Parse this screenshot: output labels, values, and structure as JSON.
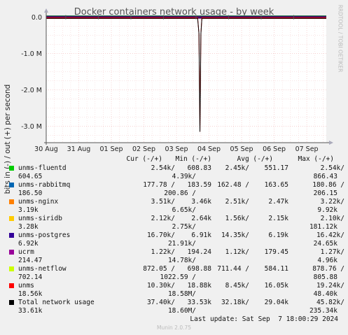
{
  "title": "Docker containers network usage - by week",
  "side_label": "RRDTOOL / TOBI OETIKER",
  "footer": "Last update: Sat Sep  7 18:00:29 2024",
  "munin": "Munin 2.0.75",
  "legend_header": {
    "cur": "Cur (-/+)",
    "min": "Min (-/+)",
    "avg": "Avg (-/+)",
    "max": "Max (-/+)"
  },
  "legend": [
    {
      "name": "unms-fluentd",
      "color": "#00cc00",
      "cur": "2.54k/",
      "min": "608.83",
      "min_wrap": "4.39k/",
      "avg": "2.45k/",
      "avg2": "551.17",
      "max": "2.54k/",
      "max_wrap": "866.43",
      "cur_wrap": "604.65"
    },
    {
      "name": "unms-rabbitmq",
      "color": "#0066b3",
      "cur": "177.78 /",
      "min": "183.59",
      "min_wrap": "200.86 /",
      "avg": "162.48 /",
      "avg2": "163.65",
      "max": "180.86 /",
      "max_wrap": "206.15",
      "cur_wrap": "186.50"
    },
    {
      "name": "unms-nginx",
      "color": "#ff8000",
      "cur": "3.51k/",
      "min": "3.46k",
      "min_wrap": "6.65k/",
      "avg": "2.51k/",
      "avg2": "2.47k",
      "max": "3.22k/",
      "max_wrap": "9.92k",
      "cur_wrap": "3.19k"
    },
    {
      "name": "unms-siridb",
      "color": "#ffcc00",
      "cur": "2.12k/",
      "min": "2.64k",
      "min_wrap": "2.75k/",
      "avg": "1.56k/",
      "avg2": "2.15k",
      "max": "2.10k/",
      "max_wrap": "181.12k",
      "cur_wrap": "3.28k"
    },
    {
      "name": "unms-postgres",
      "color": "#330099",
      "cur": "16.70k/",
      "min": "6.91k",
      "min_wrap": "21.91k/",
      "avg": "14.35k/",
      "avg2": "6.19k",
      "max": "16.42k/",
      "max_wrap": "24.65k",
      "cur_wrap": "6.92k"
    },
    {
      "name": "ucrm",
      "color": "#990099",
      "cur": "1.22k/",
      "min": "194.24",
      "min_wrap": "14.78k/",
      "avg": "1.12k/",
      "avg2": "179.45",
      "max": "1.27k/",
      "max_wrap": "4.96k",
      "cur_wrap": "214.47"
    },
    {
      "name": "unms-netflow",
      "color": "#ccff00",
      "cur": "872.05 /",
      "min": "698.88",
      "min_wrap": "1022.59 /",
      "avg": "711.44 /",
      "avg2": "584.11",
      "max": "878.76 /",
      "max_wrap": "805.88",
      "cur_wrap": "702.14"
    },
    {
      "name": "unms",
      "color": "#ff0000",
      "cur": "10.30k/",
      "min": "18.88k",
      "min_wrap": "18.58M/",
      "avg": "8.45k/",
      "avg2": "16.05k",
      "max": "19.24k/",
      "max_wrap": "48.40k",
      "cur_wrap": "18.56k"
    },
    {
      "name": "Total network usage",
      "color": "#000000",
      "cur": "37.40k/",
      "min": "33.53k",
      "min_wrap": "18.60M/",
      "avg": "32.18k/",
      "avg2": "29.04k",
      "max": "45.82k/",
      "max_wrap": "235.34k",
      "cur_wrap": "33.61k"
    }
  ],
  "chart_data": {
    "type": "line",
    "title": "Docker containers network usage - by week",
    "xlabel": "",
    "ylabel": "bits in (-) / out (+) per second",
    "x_ticks": [
      "30 Aug",
      "31 Aug",
      "01 Sep",
      "02 Sep",
      "03 Sep",
      "04 Sep",
      "05 Sep",
      "06 Sep",
      "07 Sep"
    ],
    "y_ticks": [
      {
        "value": 0,
        "label": "0.0"
      },
      {
        "value": -1000000,
        "label": "-1.0 M"
      },
      {
        "value": -2000000,
        "label": "-2.0 M"
      },
      {
        "value": -3000000,
        "label": "-3.0 M"
      }
    ],
    "ylim": [
      -3450000,
      50000
    ],
    "xlim_days": [
      0,
      8.6
    ],
    "grid": true,
    "series": [
      {
        "name": "unms",
        "color": "#ff0000",
        "x": [
          0,
          4.65,
          4.69,
          4.72,
          4.75,
          4.78,
          8.6
        ],
        "y": [
          -18000,
          -18000,
          -450000,
          -3150000,
          -450000,
          -18000,
          -18000
        ]
      },
      {
        "name": "Total network usage",
        "color": "#000000",
        "x": [
          0,
          4.65,
          4.69,
          4.72,
          4.75,
          4.78,
          8.6
        ],
        "y": [
          -33000,
          -33000,
          -450000,
          -3150000,
          -450000,
          -33000,
          -33000
        ]
      }
    ]
  }
}
